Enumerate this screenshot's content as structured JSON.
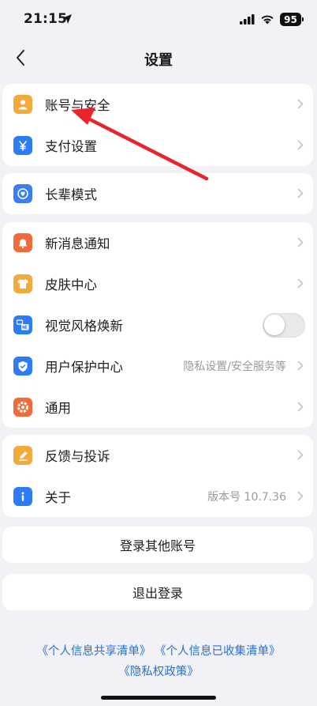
{
  "status": {
    "time": "21:15",
    "battery": "95"
  },
  "nav": {
    "title": "设置"
  },
  "groups": [
    {
      "items": [
        {
          "label": "账号与安全",
          "icon": "user-icon",
          "color": "#f4a93b"
        },
        {
          "label": "支付设置",
          "icon": "yen-icon",
          "color": "#2d7cf6"
        }
      ]
    },
    {
      "items": [
        {
          "label": "长辈模式",
          "icon": "heart-icon",
          "color": "#3a7ff2"
        }
      ]
    },
    {
      "items": [
        {
          "label": "新消息通知",
          "icon": "bell-icon",
          "color": "#f06a3c"
        },
        {
          "label": "皮肤中心",
          "icon": "shirt-icon",
          "color": "#f4a93b"
        },
        {
          "label": "视觉风格焕新",
          "icon": "new-style-icon",
          "color": "#2d7cf6",
          "toggle_on": false
        },
        {
          "label": "用户保护中心",
          "icon": "shield-icon",
          "color": "#2d7cf6",
          "detail": "隐私设置/安全服务等"
        },
        {
          "label": "通用",
          "icon": "flower-icon",
          "color": "#f06a3c"
        }
      ]
    },
    {
      "items": [
        {
          "label": "反馈与投诉",
          "icon": "pen-icon",
          "color": "#f4a93b"
        },
        {
          "label": "关于",
          "icon": "info-icon",
          "color": "#2d7cf6",
          "detail": "版本号 10.7.36"
        }
      ]
    }
  ],
  "buttons": {
    "switch_account": "登录其他账号",
    "logout": "退出登录"
  },
  "footer": {
    "link_shared": "《个人信息共享清单》",
    "link_collected": "《个人信息已收集清单》",
    "link_privacy": "《隐私权政策》",
    "link_color": "#2a6fd6"
  },
  "annotation": {
    "arrow_color": "#e8252b"
  }
}
